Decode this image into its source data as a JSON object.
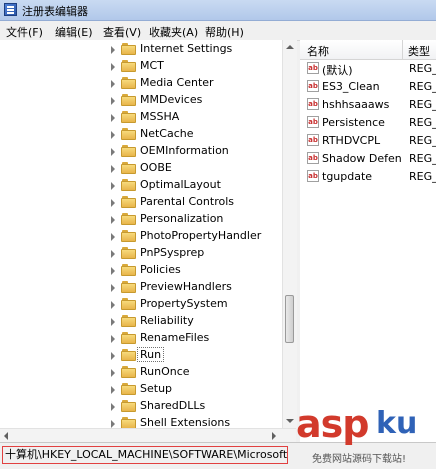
{
  "window": {
    "title": "注册表编辑器"
  },
  "menu": [
    "文件(F)",
    "编辑(E)",
    "查看(V)",
    "收藏夹(A)",
    "帮助(H)"
  ],
  "tree": {
    "items": [
      {
        "label": "Internet Settings"
      },
      {
        "label": "MCT"
      },
      {
        "label": "Media Center"
      },
      {
        "label": "MMDevices"
      },
      {
        "label": "MSSHA"
      },
      {
        "label": "NetCache"
      },
      {
        "label": "OEMInformation"
      },
      {
        "label": "OOBE"
      },
      {
        "label": "OptimalLayout"
      },
      {
        "label": "Parental Controls"
      },
      {
        "label": "Personalization"
      },
      {
        "label": "PhotoPropertyHandler"
      },
      {
        "label": "PnPSysprep"
      },
      {
        "label": "Policies"
      },
      {
        "label": "PreviewHandlers"
      },
      {
        "label": "PropertySystem"
      },
      {
        "label": "Reliability"
      },
      {
        "label": "RenameFiles"
      },
      {
        "label": "Run",
        "selected": true
      },
      {
        "label": "RunOnce"
      },
      {
        "label": "Setup"
      },
      {
        "label": "SharedDLLs"
      },
      {
        "label": "Shell Extensions"
      }
    ]
  },
  "list": {
    "columns": [
      "名称",
      "类型"
    ],
    "rows": [
      {
        "name": "(默认)",
        "type": "REG_S"
      },
      {
        "name": "ES3_Clean",
        "type": "REG_S"
      },
      {
        "name": "hshhsaaaws",
        "type": "REG_S"
      },
      {
        "name": "Persistence",
        "type": "REG_S"
      },
      {
        "name": "RTHDVCPL",
        "type": "REG_S"
      },
      {
        "name": "Shadow Defen...",
        "type": "REG_S"
      },
      {
        "name": "tgupdate",
        "type": "REG_S"
      }
    ],
    "icon_label": "ab"
  },
  "status": {
    "path": "十算机\\HKEY_LOCAL_MACHINE\\SOFTWARE\\Microsoft\\Wi"
  },
  "watermark": {
    "brand": "asp",
    "brand2": "ku",
    "sub": "免费网站源码下载站!"
  },
  "colors": {
    "titlebar": "#b9cdec",
    "watermark_red": "#d23a2c",
    "watermark_blue": "#2f62b7",
    "folder": "#f0c85a"
  }
}
